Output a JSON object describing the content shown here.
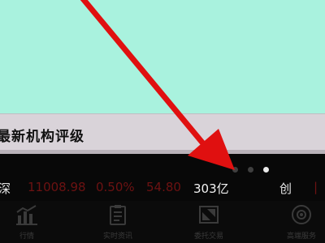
{
  "section": {
    "title": "最新机构评级"
  },
  "pager": {
    "dots": 3,
    "active_index": 2
  },
  "ticker": {
    "market_1": "深",
    "index_value": "11008.98",
    "change_pct": "0.50%",
    "change_points": "54.80",
    "volume": "303亿",
    "market_2": "创"
  },
  "tabs": [
    {
      "label": "行情",
      "icon": "chart-icon"
    },
    {
      "label": "实时资讯",
      "icon": "news-icon"
    },
    {
      "label": "委托交易",
      "icon": "trade-arrows-icon"
    },
    {
      "label": "高端服务",
      "icon": "premium-service-icon"
    }
  ],
  "colors": {
    "content_bg": "#a9f2de",
    "section_bg": "#d9d3d9",
    "panel_bg": "#080808",
    "ticker_red": "#6d1212",
    "annotation_arrow": "#e01010"
  }
}
